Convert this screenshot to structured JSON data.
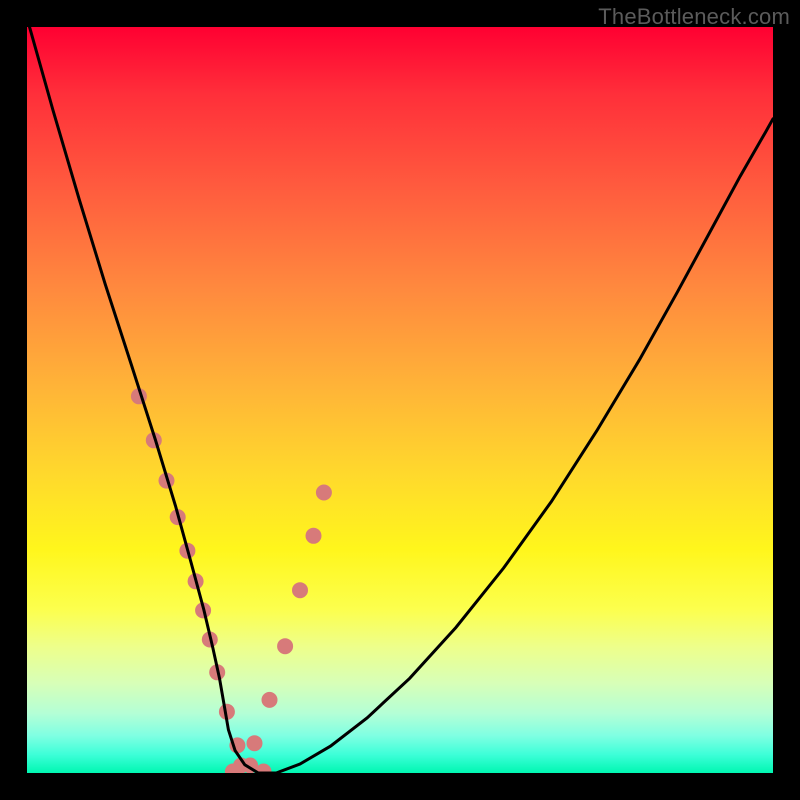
{
  "watermark": {
    "text": "TheBottleneck.com"
  },
  "chart_data": {
    "type": "line",
    "title": "",
    "xlabel": "",
    "ylabel": "",
    "xlim": [
      0,
      1
    ],
    "ylim": [
      0,
      1
    ],
    "grid": false,
    "legend": false,
    "series": [
      {
        "name": "curve",
        "color": "#000000",
        "x": [
          0.0,
          0.035,
          0.07,
          0.105,
          0.14,
          0.172,
          0.199,
          0.22,
          0.237,
          0.249,
          0.258,
          0.264,
          0.27,
          0.279,
          0.292,
          0.31,
          0.334,
          0.366,
          0.407,
          0.456,
          0.513,
          0.575,
          0.639,
          0.703,
          0.764,
          0.821,
          0.872,
          0.917,
          0.956,
          0.99,
          1.0
        ],
        "y": [
          1.012,
          0.888,
          0.769,
          0.655,
          0.547,
          0.447,
          0.358,
          0.282,
          0.219,
          0.168,
          0.127,
          0.093,
          0.058,
          0.03,
          0.011,
          0.0,
          0.0,
          0.012,
          0.036,
          0.074,
          0.127,
          0.195,
          0.275,
          0.364,
          0.459,
          0.554,
          0.645,
          0.728,
          0.8,
          0.859,
          0.877
        ]
      }
    ],
    "markers": {
      "name": "dots",
      "color": "#d77a7a",
      "radius_px": 8,
      "x": [
        0.15,
        0.17,
        0.187,
        0.202,
        0.215,
        0.226,
        0.236,
        0.245,
        0.255,
        0.268,
        0.282,
        0.299,
        0.317,
        0.276,
        0.287,
        0.305,
        0.325,
        0.346,
        0.366,
        0.384,
        0.398
      ],
      "y": [
        0.505,
        0.446,
        0.392,
        0.343,
        0.298,
        0.257,
        0.218,
        0.179,
        0.135,
        0.082,
        0.037,
        0.01,
        0.002,
        0.002,
        0.01,
        0.04,
        0.098,
        0.17,
        0.245,
        0.318,
        0.376
      ]
    },
    "gradient_stops": [
      {
        "pos": 0.0,
        "color": "#ff0032"
      },
      {
        "pos": 0.09,
        "color": "#ff2f3a"
      },
      {
        "pos": 0.22,
        "color": "#ff5d3e"
      },
      {
        "pos": 0.35,
        "color": "#ff893e"
      },
      {
        "pos": 0.48,
        "color": "#ffb338"
      },
      {
        "pos": 0.6,
        "color": "#ffd92c"
      },
      {
        "pos": 0.7,
        "color": "#fff61c"
      },
      {
        "pos": 0.78,
        "color": "#fcff4d"
      },
      {
        "pos": 0.83,
        "color": "#eeff8a"
      },
      {
        "pos": 0.88,
        "color": "#d7ffb8"
      },
      {
        "pos": 0.92,
        "color": "#b4ffd6"
      },
      {
        "pos": 0.95,
        "color": "#7fffe2"
      },
      {
        "pos": 0.975,
        "color": "#3effd8"
      },
      {
        "pos": 1.0,
        "color": "#00f7b2"
      }
    ]
  }
}
